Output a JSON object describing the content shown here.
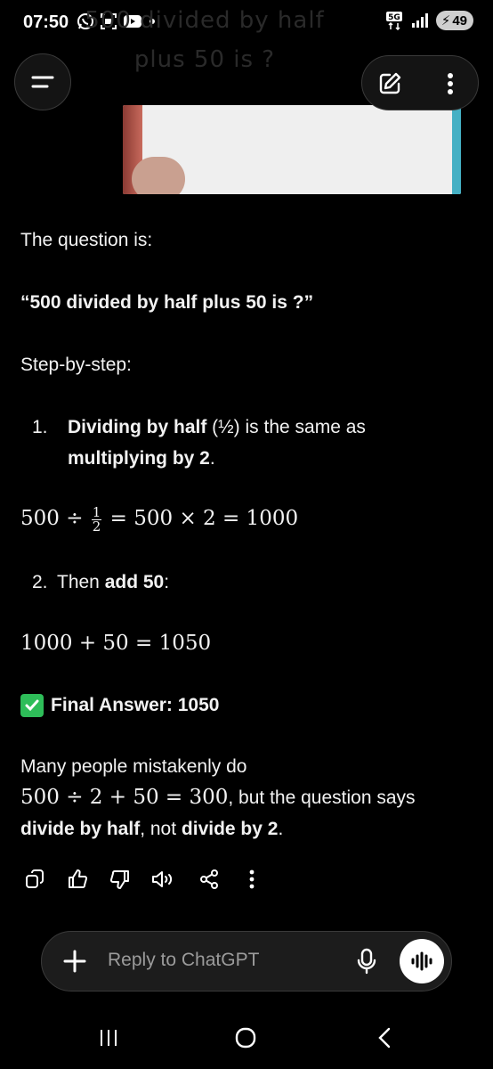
{
  "status_bar": {
    "time": "07:50",
    "signal_label": "5G",
    "battery": "49"
  },
  "photo": {
    "line1": "500 divided by half",
    "line2": "plus 50 is ?"
  },
  "message": {
    "intro": "The question is:",
    "quote": "“500 divided by half plus 50 is ?”",
    "steps_heading": "Step-by-step:",
    "step1": {
      "num": "1.",
      "bold_a": "Dividing by half",
      "text_a": " (½) is the same as",
      "bold_b": "multiplying by 2",
      "text_b": "."
    },
    "eq1": {
      "lhs": "500 ÷ ",
      "num": "1",
      "den": "2",
      "rhs": " = 500 × 2 = 1000"
    },
    "step2": {
      "num": "2.",
      "text": "Then ",
      "bold": "add 50",
      "tail": ":"
    },
    "eq2": "1000 + 50 = 1050",
    "final": {
      "icon": "✅",
      "text": "Final Answer: 1050"
    },
    "note": {
      "line1": "Many people mistakenly do",
      "math": "500 ÷ 2 + 50 = 300",
      "line2_tail": ", but the question says",
      "bold_a": "divide by half",
      "mid": ", not ",
      "bold_b": "divide by 2",
      "end": "."
    }
  },
  "composer": {
    "placeholder": "Reply to ChatGPT"
  },
  "icons": {
    "menu": "menu-icon",
    "edit": "edit-icon",
    "more": "more-vertical-icon",
    "copy": "copy-icon",
    "like": "thumbs-up-icon",
    "dislike": "thumbs-down-icon",
    "speaker": "speaker-icon",
    "share": "share-icon",
    "plus": "plus-icon",
    "mic": "microphone-icon",
    "voice": "voice-mode-icon"
  },
  "colors": {
    "background": "#000000",
    "text": "#f2f2f2",
    "placeholder": "#9b9b9b",
    "check": "#2ebd59"
  }
}
